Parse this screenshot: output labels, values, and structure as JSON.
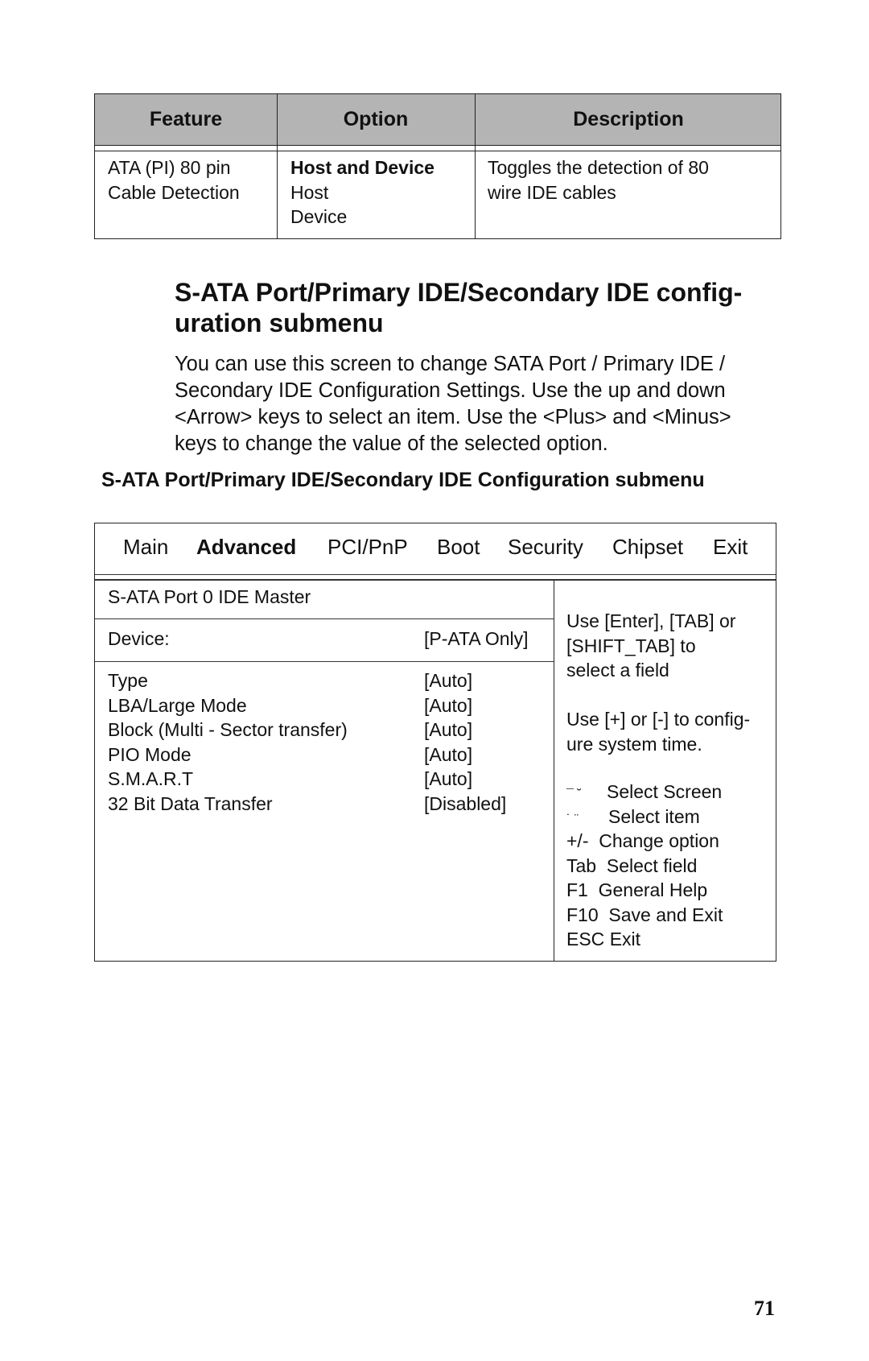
{
  "feature_table": {
    "headers": [
      "Feature",
      "Option",
      "Description"
    ],
    "rows": [
      {
        "feature": [
          "ATA (PI) 80 pin",
          "Cable Detection"
        ],
        "options": [
          {
            "label": "Host and Device",
            "default": true
          },
          {
            "label": "Host",
            "default": false
          },
          {
            "label": "Device",
            "default": false
          }
        ],
        "description": [
          "Toggles the detection of 80",
          "wire IDE cables"
        ]
      }
    ]
  },
  "section": {
    "heading_lines": [
      "S-ATA Port/Primary IDE/Secondary IDE config-",
      "uration submenu"
    ],
    "paragraph_lines": [
      "You can use this screen to change SATA Port / Primary IDE /",
      "Secondary IDE Configuration Settings. Use the up and down",
      "<Arrow> keys to select an item. Use the <Plus> and <Minus>",
      "keys to change the value of the selected option."
    ],
    "caption": "S-ATA Port/Primary IDE/Secondary IDE Configuration submenu"
  },
  "bios": {
    "menu": [
      {
        "label": "Main",
        "active": false
      },
      {
        "label": "Advanced",
        "active": true
      },
      {
        "label": "PCI/PnP",
        "active": false
      },
      {
        "label": "Boot",
        "active": false
      },
      {
        "label": "Security",
        "active": false
      },
      {
        "label": "Chipset",
        "active": false
      },
      {
        "label": "Exit",
        "active": false
      }
    ],
    "panel_title": "S-ATA Port 0 IDE Master",
    "device": {
      "label": "Device:",
      "value": "[P-ATA Only]"
    },
    "settings": [
      {
        "label": "Type",
        "value": "[Auto]"
      },
      {
        "label": "LBA/Large Mode",
        "value": "[Auto]"
      },
      {
        "label": "Block (Multi - Sector transfer)",
        "value": "[Auto]"
      },
      {
        "label": "PIO Mode",
        "value": "[Auto]"
      },
      {
        "label": "S.M.A.R.T",
        "value": "[Auto]"
      },
      {
        "label": "32 Bit Data Transfer",
        "value": "[Disabled]"
      }
    ],
    "help": {
      "para1": [
        "Use [Enter], [TAB] or",
        "[SHIFT_TAB] to",
        "select a field"
      ],
      "para2": [
        "Use [+] or [-] to config-",
        "ure system time."
      ],
      "keys": [
        {
          "key": "¯ ˘",
          "action": "Select Screen"
        },
        {
          "key": "˙ ¨",
          "action": "Select item"
        },
        {
          "key": "+/-",
          "action": "Change option"
        },
        {
          "key": "Tab",
          "action": "Select field"
        },
        {
          "key": "F1",
          "action": "General Help"
        },
        {
          "key": "F10",
          "action": "Save and Exit"
        },
        {
          "key": "ESC",
          "action": "Exit"
        }
      ]
    }
  },
  "page_number": "71"
}
